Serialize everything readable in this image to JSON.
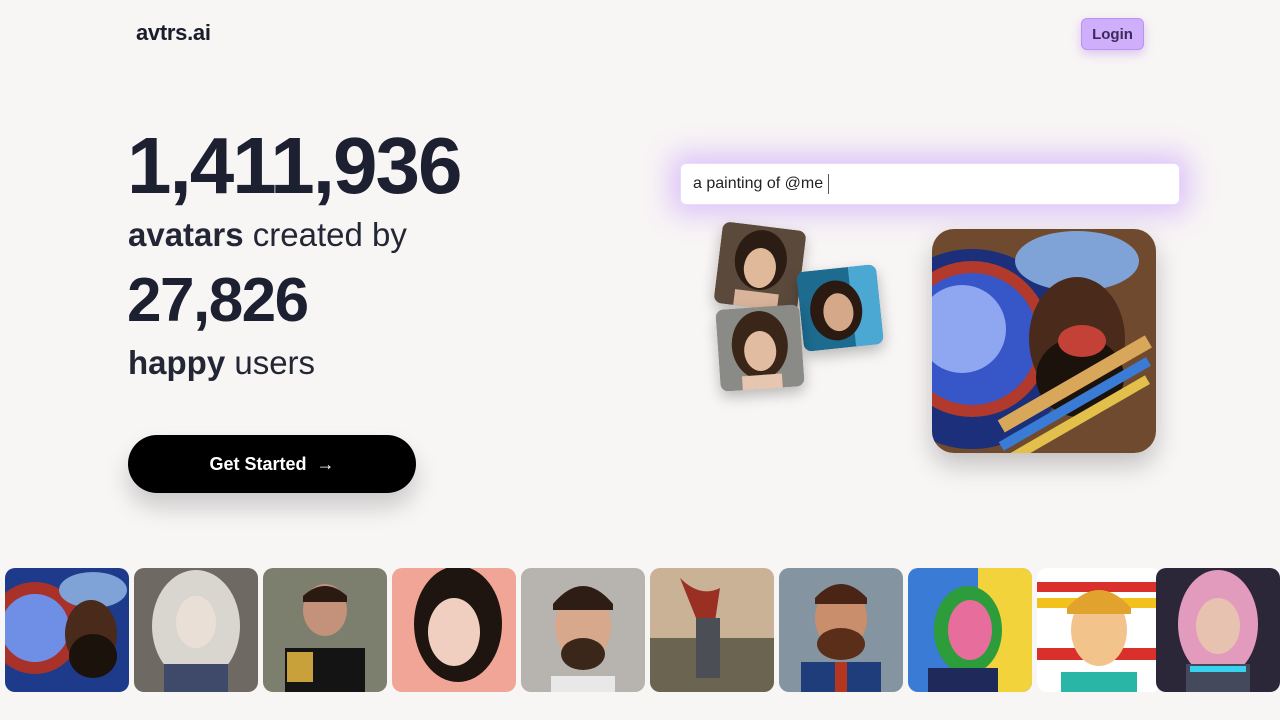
{
  "header": {
    "logo": "avtrs.ai",
    "login_label": "Login"
  },
  "hero": {
    "avatars_count": "1,411,936",
    "line1_bold": "avatars",
    "line1_rest": " created by",
    "users_count": "27,826",
    "line2_bold": "happy",
    "line2_rest": " users",
    "cta_label": "Get Started",
    "cta_arrow": "→"
  },
  "demo": {
    "prompt_text": "a painting of @me"
  },
  "colors": {
    "background": "#f8f5f5",
    "login_bg": "#cfaefc",
    "cta_bg": "#000000",
    "text_dark": "#1c2030"
  }
}
